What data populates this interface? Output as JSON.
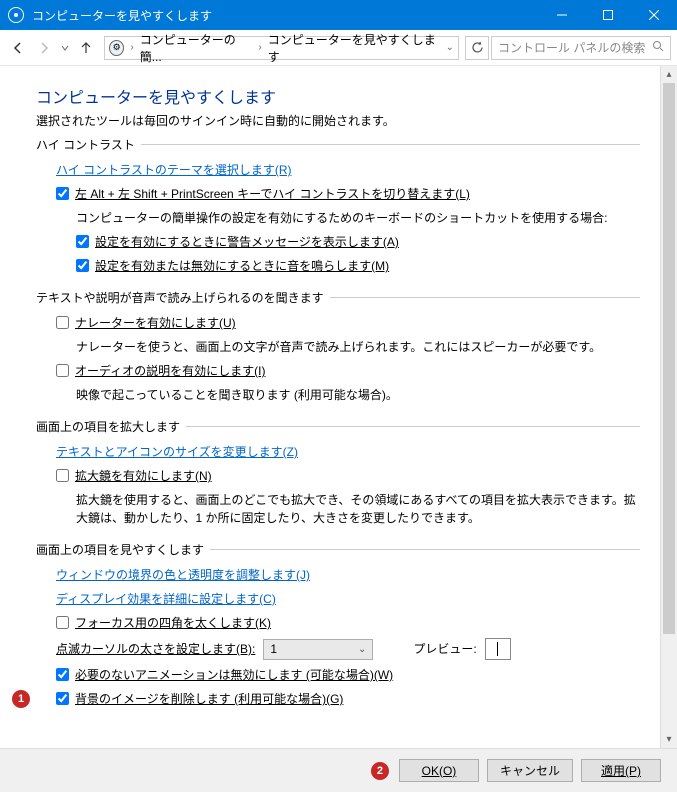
{
  "titlebar": {
    "title": "コンピューターを見やすくします"
  },
  "nav": {
    "breadcrumb1": "コンピューターの簡...",
    "breadcrumb2": "コンピューターを見やすくします",
    "search_placeholder": "コントロール パネルの検索"
  },
  "page": {
    "title": "コンピューターを見やすくします",
    "subtitle": "選択されたツールは毎回のサインイン時に自動的に開始されます。"
  },
  "highcontrast": {
    "legend": "ハイ コントラスト",
    "choose_theme": "ハイ コントラストのテーマを選択します(R)",
    "toggle_label": "左 Alt + 左 Shift + PrintScreen キーでハイ コントラストを切り替えます(L)",
    "keyboard_note": "コンピューターの簡単操作の設定を有効にするためのキーボードのショートカットを使用する場合:",
    "warn_label": "設定を有効にするときに警告メッセージを表示します(A)",
    "sound_label": "設定を有効または無効にするときに音を鳴らします(M)"
  },
  "narrator": {
    "legend": "テキストや説明が音声で読み上げられるのを聞きます",
    "enable_label": "ナレーターを有効にします(U)",
    "enable_desc": "ナレーターを使うと、画面上の文字が音声で読み上げられます。これにはスピーカーが必要です。",
    "audio_label": "オーディオの説明を有効にします(I)",
    "audio_desc": "映像で起こっていることを聞き取ります (利用可能な場合)。"
  },
  "magnify": {
    "legend": "画面上の項目を拡大します",
    "resize_link": "テキストとアイコンのサイズを変更します(Z)",
    "enable_label": "拡大鏡を有効にします(N)",
    "enable_desc": "拡大鏡を使用すると、画面上のどこでも拡大でき、その領域にあるすべての項目を拡大表示できます。拡大鏡は、動かしたり、1 か所に固定したり、大きさを変更したりできます。"
  },
  "easier": {
    "legend": "画面上の項目を見やすくします",
    "border_link": "ウィンドウの境界の色と透明度を調整します(J)",
    "display_link": "ディスプレイ効果を詳細に設定します(C)",
    "focus_label": "フォーカス用の四角を太くします(K)",
    "cursor_label": "点滅カーソルの太さを設定します(B):",
    "cursor_value": "1",
    "preview_label": "プレビュー:",
    "anim_label": "必要のないアニメーションは無効にします (可能な場合)(W)",
    "bg_label": "背景のイメージを削除します (利用可能な場合)(G)"
  },
  "footer": {
    "ok": "OK(O)",
    "cancel": "キャンセル",
    "apply": "適用(P)"
  },
  "annotations": {
    "one": "1",
    "two": "2"
  }
}
